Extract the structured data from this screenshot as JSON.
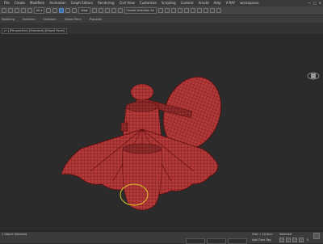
{
  "menu": {
    "items": [
      "File",
      "Create",
      "Modifiers",
      "Animation",
      "Graph Editors",
      "Rendering",
      "Civil View",
      "Customize",
      "Scripting",
      "Content",
      "Arnold",
      "Help",
      "V-RAY",
      "workspaces"
    ]
  },
  "window": {
    "minimize": "—",
    "maximize": "□",
    "close": "✕"
  },
  "toolbar": {
    "view_select": "View",
    "selection_set": "Create Selection Se"
  },
  "ribbon": {
    "tabs": [
      "Modeling",
      "Freeform",
      "Selection",
      "Object Paint",
      "Populate"
    ]
  },
  "viewport": {
    "label": "[+] [Perspective] [Standard] [Edged Faces]"
  },
  "status": {
    "object_count": "1 Object Selected",
    "coords": "Grid = 10.0cm",
    "add_time_tag": "Add Time Tag",
    "selected": "Selected",
    "frame": "0"
  },
  "colors": {
    "model_fill": "#b33a3a",
    "model_line": "#5a0a0a",
    "background": "#2b2b2b"
  }
}
